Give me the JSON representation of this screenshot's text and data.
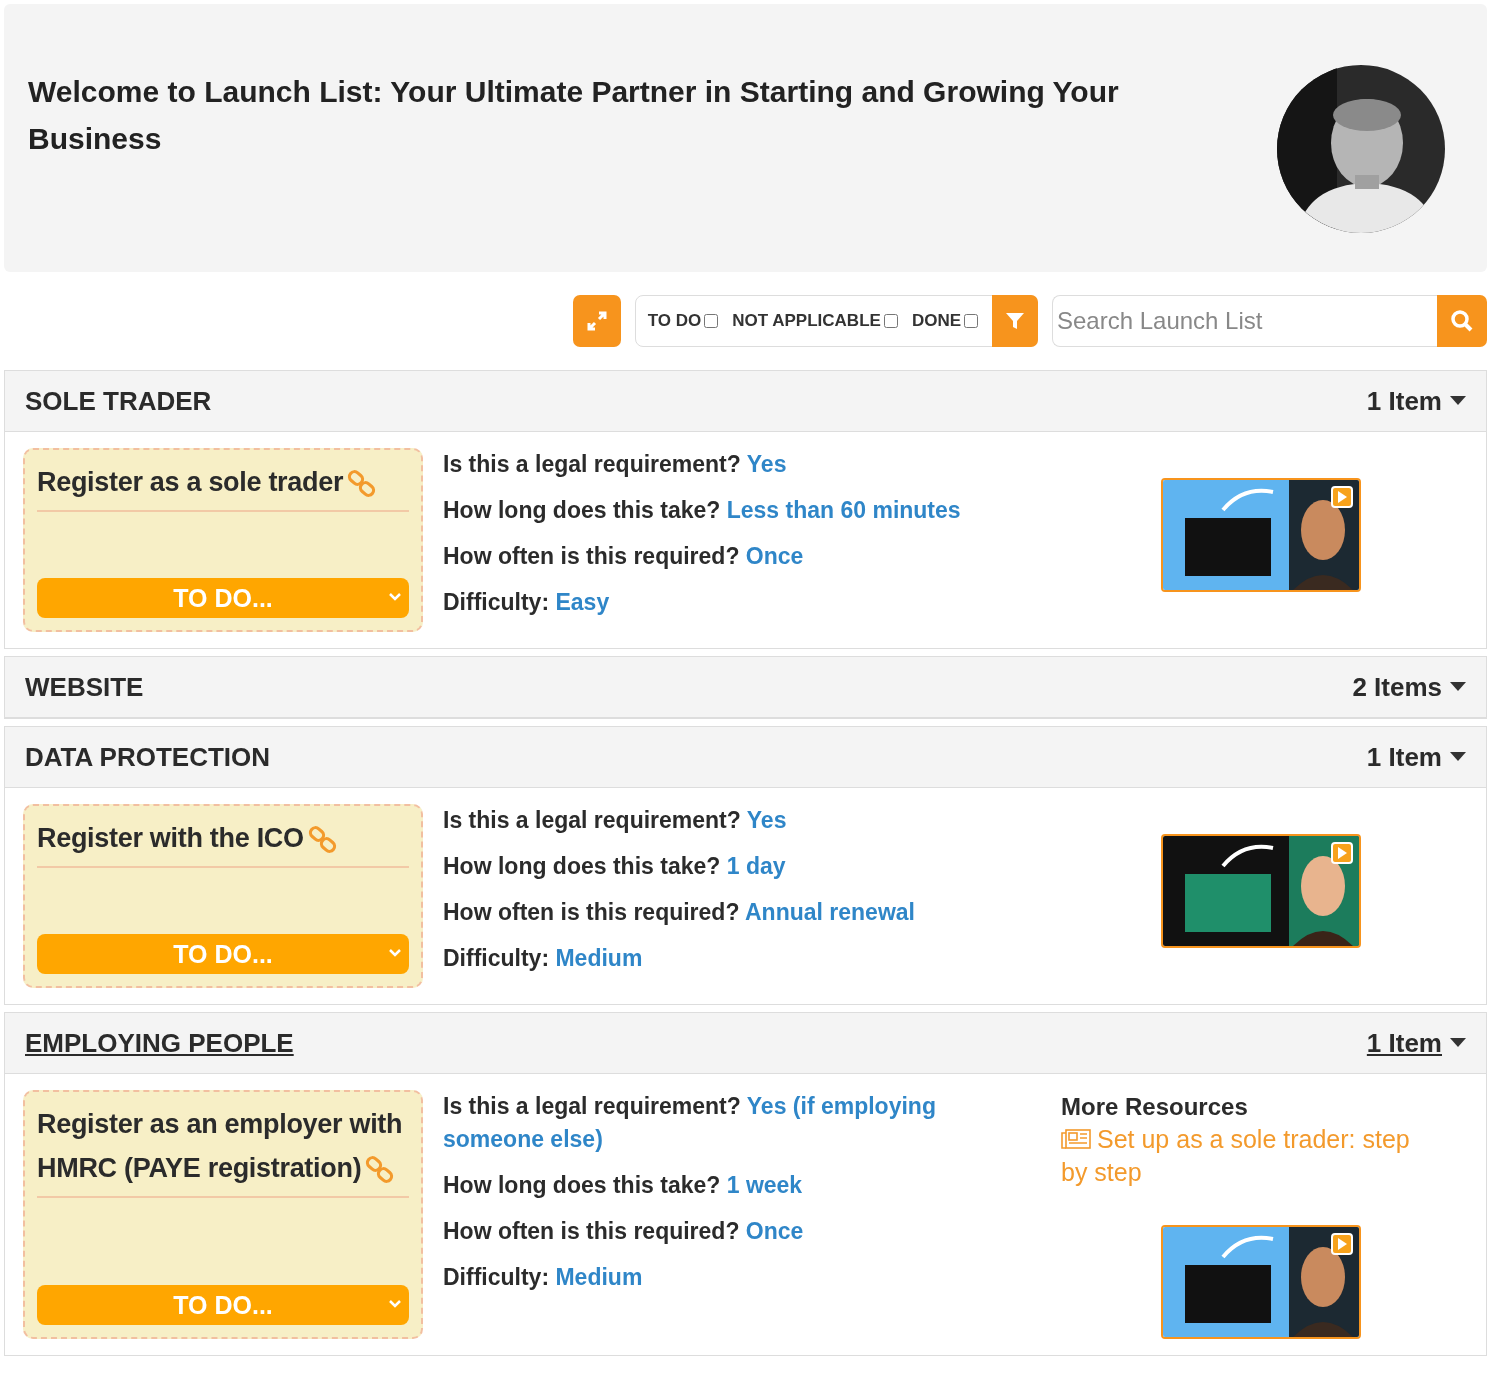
{
  "header": {
    "title": "Welcome to Launch List: Your Ultimate Partner in Starting and Growing Your Business"
  },
  "toolbar": {
    "filters": [
      {
        "label": "TO DO",
        "checked": false
      },
      {
        "label": "NOT APPLICABLE",
        "checked": false
      },
      {
        "label": "DONE",
        "checked": false
      }
    ],
    "search": {
      "placeholder": "Search Launch List"
    }
  },
  "sections": [
    {
      "title": "SOLE TRADER",
      "count": "1 Item",
      "hovered": false,
      "items": [
        {
          "title": "Register as a sole trader",
          "status": "TO DO...",
          "details": [
            {
              "label": "Is this a legal requirement?",
              "answer": "Yes"
            },
            {
              "label": "How long does this take?",
              "answer": "Less than 60 minutes"
            },
            {
              "label": "How often is this required?",
              "answer": "Once"
            },
            {
              "label": "Difficulty:",
              "answer": "Easy"
            }
          ]
        }
      ]
    },
    {
      "title": "WEBSITE",
      "count": "2 Items",
      "hovered": false
    },
    {
      "title": "DATA PROTECTION",
      "count": "1 Item",
      "hovered": false,
      "items": [
        {
          "title": "Register with the ICO",
          "status": "TO DO...",
          "details": [
            {
              "label": "Is this a legal requirement?",
              "answer": "Yes"
            },
            {
              "label": "How long does this take?",
              "answer": "1 day"
            },
            {
              "label": "How often is this required?",
              "answer": "Annual renewal"
            },
            {
              "label": "Difficulty:",
              "answer": "Medium"
            }
          ]
        }
      ]
    },
    {
      "title": "EMPLOYING PEOPLE",
      "count": "1 Item",
      "hovered": true,
      "items": [
        {
          "title": "Register as an employer with HMRC (PAYE registration)",
          "status": "TO DO...",
          "details": [
            {
              "label": "Is this a legal requirement?",
              "answer": "Yes (if employing someone else)"
            },
            {
              "label": "How long does this take?",
              "answer": "1 week"
            },
            {
              "label": "How often is this required?",
              "answer": "Once"
            },
            {
              "label": "Difficulty:",
              "answer": "Medium"
            }
          ],
          "resources": {
            "title": "More Resources",
            "links": [
              "Set up as a sole trader: step by step"
            ]
          }
        }
      ]
    }
  ]
}
